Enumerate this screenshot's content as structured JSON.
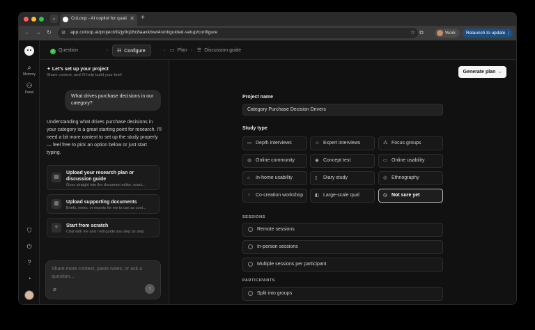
{
  "browser": {
    "tab_title": "CoLoop - AI copilot for qualitati",
    "url": "app.coloop.ai/project/llizjy9q16c8aaxklxwt4sml/guided-setup/configure",
    "profile_label": "Work",
    "relaunch_label": "Relaunch to update"
  },
  "rail": {
    "items": [
      {
        "label": "Memory",
        "icon": "search-icon"
      },
      {
        "label": "Panel",
        "icon": "users-icon"
      }
    ]
  },
  "steps": [
    {
      "label": "Question",
      "state": "done"
    },
    {
      "label": "Configure",
      "state": "active"
    },
    {
      "label": "Plan",
      "state": "pending"
    },
    {
      "label": "Discussion guide",
      "state": "pending"
    }
  ],
  "left": {
    "title": "Let's set up your project",
    "subtitle": "Share context, and I'll help build your brief",
    "user_message": "What drives purchase decisions in our category?",
    "assistant_message": "Understanding what drives purchase decisions in your category is a great starting point for research. I'll need a bit more context to set up the study properly — feel free to pick an option below or just start typing.",
    "options": [
      {
        "title": "Upload your research plan or discussion guide",
        "desc": "Goes straight into the document editor, exact...",
        "icon": "document-icon"
      },
      {
        "title": "Upload supporting documents",
        "desc": "Briefs, notes, or reports for me to use as cont...",
        "icon": "documents-icon"
      },
      {
        "title": "Start from scratch",
        "desc": "Chat with me and I will guide you step by step",
        "icon": "sparkle-icon"
      }
    ],
    "chat_placeholder": "Share more context, paste notes, or ask a question..."
  },
  "right": {
    "generate_label": "Generate plan",
    "project_name_label": "Project name",
    "project_name_value": "Category Purchase Decision Drivers",
    "study_type_label": "Study type",
    "study_types": [
      {
        "label": "Depth interviews",
        "icon": "chat-icon",
        "selected": false
      },
      {
        "label": "Expert interviews",
        "icon": "user-icon",
        "selected": false
      },
      {
        "label": "Focus groups",
        "icon": "group-icon",
        "selected": false
      },
      {
        "label": "Online community",
        "icon": "globe-icon",
        "selected": false
      },
      {
        "label": "Concept test",
        "icon": "eye-icon",
        "selected": false
      },
      {
        "label": "Online usability",
        "icon": "monitor-icon",
        "selected": false
      },
      {
        "label": "In-home usability",
        "icon": "home-icon",
        "selected": false
      },
      {
        "label": "Diary study",
        "icon": "book-icon",
        "selected": false
      },
      {
        "label": "Ethnography",
        "icon": "compass-icon",
        "selected": false
      },
      {
        "label": "Co-creation workshop",
        "icon": "bulb-icon",
        "selected": false
      },
      {
        "label": "Large-scale qual",
        "icon": "layers-icon",
        "selected": false
      },
      {
        "label": "Not sure yet",
        "icon": "clock-icon",
        "selected": true
      }
    ],
    "sessions_label": "SESSIONS",
    "sessions": [
      "Remote sessions",
      "In-person sessions",
      "Multiple sessions per participant"
    ],
    "participants_label": "PARTICIPANTS",
    "participants": [
      "Split into groups"
    ]
  }
}
